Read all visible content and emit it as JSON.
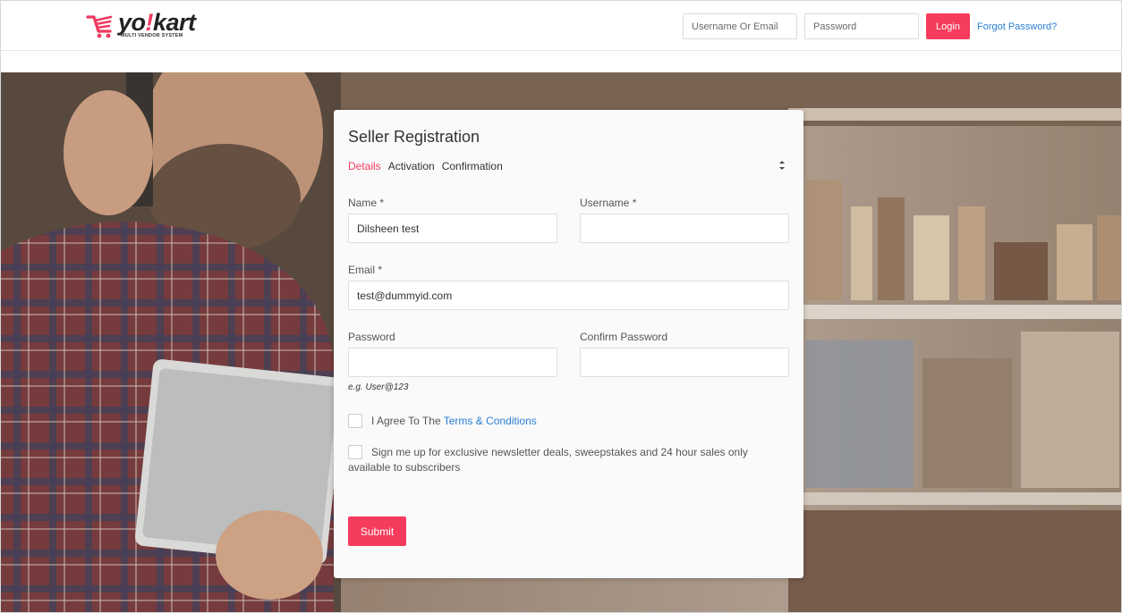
{
  "header": {
    "logo_word_a": "yo",
    "logo_word_b": "!",
    "logo_word_c": "kart",
    "logo_tagline": "MULTI VENDOR SYSTEM",
    "username_placeholder": "Username Or Email",
    "password_placeholder": "Password",
    "login_label": "Login",
    "forgot_label": "Forgot Password?"
  },
  "form": {
    "title": "Seller Registration",
    "steps": [
      {
        "label": "Details",
        "active": true
      },
      {
        "label": "Activation",
        "active": false
      },
      {
        "label": "Confirmation",
        "active": false
      }
    ],
    "name_label": "Name *",
    "name_value": "Dilsheen test",
    "username_label": "Username *",
    "username_value": "",
    "email_label": "Email *",
    "email_value": "test@dummyid.com",
    "password_label": "Password",
    "confirm_password_label": "Confirm Password",
    "password_hint": "e.g. User@123",
    "terms_prefix": "I Agree To The ",
    "terms_link": "Terms & Conditions",
    "newsletter_text": "Sign me up for exclusive newsletter deals, sweepstakes and 24 hour sales only available to subscribers",
    "submit_label": "Submit"
  },
  "colors": {
    "accent": "#f53c5c",
    "link": "#2a7fd4"
  }
}
